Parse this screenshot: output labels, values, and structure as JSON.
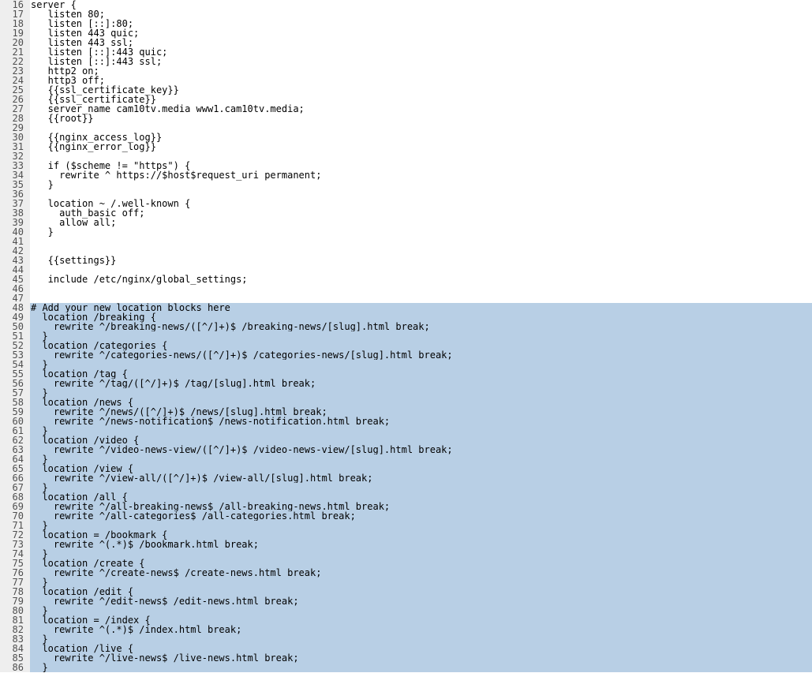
{
  "lines": [
    {
      "num": 16,
      "text": "server {",
      "hl": false
    },
    {
      "num": 17,
      "text": "   listen 80;",
      "hl": false
    },
    {
      "num": 18,
      "text": "   listen [::]:80;",
      "hl": false
    },
    {
      "num": 19,
      "text": "   listen 443 quic;",
      "hl": false
    },
    {
      "num": 20,
      "text": "   listen 443 ssl;",
      "hl": false
    },
    {
      "num": 21,
      "text": "   listen [::]:443 quic;",
      "hl": false
    },
    {
      "num": 22,
      "text": "   listen [::]:443 ssl;",
      "hl": false
    },
    {
      "num": 23,
      "text": "   http2 on;",
      "hl": false
    },
    {
      "num": 24,
      "text": "   http3 off;",
      "hl": false
    },
    {
      "num": 25,
      "text": "   {{ssl_certificate_key}}",
      "hl": false
    },
    {
      "num": 26,
      "text": "   {{ssl_certificate}}",
      "hl": false
    },
    {
      "num": 27,
      "text": "   server_name cam10tv.media www1.cam10tv.media;",
      "hl": false
    },
    {
      "num": 28,
      "text": "   {{root}}",
      "hl": false
    },
    {
      "num": 29,
      "text": "",
      "hl": false
    },
    {
      "num": 30,
      "text": "   {{nginx_access_log}}",
      "hl": false
    },
    {
      "num": 31,
      "text": "   {{nginx_error_log}}",
      "hl": false
    },
    {
      "num": 32,
      "text": "",
      "hl": false
    },
    {
      "num": 33,
      "text": "   if ($scheme != \"https\") {",
      "hl": false
    },
    {
      "num": 34,
      "text": "     rewrite ^ https://$host$request_uri permanent;",
      "hl": false
    },
    {
      "num": 35,
      "text": "   }",
      "hl": false
    },
    {
      "num": 36,
      "text": "",
      "hl": false
    },
    {
      "num": 37,
      "text": "   location ~ /.well-known {",
      "hl": false
    },
    {
      "num": 38,
      "text": "     auth_basic off;",
      "hl": false
    },
    {
      "num": 39,
      "text": "     allow all;",
      "hl": false
    },
    {
      "num": 40,
      "text": "   }",
      "hl": false
    },
    {
      "num": 41,
      "text": "",
      "hl": false
    },
    {
      "num": 42,
      "text": "",
      "hl": false
    },
    {
      "num": 43,
      "text": "   {{settings}}",
      "hl": false
    },
    {
      "num": 44,
      "text": "",
      "hl": false
    },
    {
      "num": 45,
      "text": "   include /etc/nginx/global_settings;",
      "hl": false
    },
    {
      "num": 46,
      "text": "",
      "hl": false
    },
    {
      "num": 47,
      "text": "",
      "hl": true
    },
    {
      "num": 48,
      "text": "# Add your new location blocks here",
      "hl": true
    },
    {
      "num": 49,
      "text": "  location /breaking {",
      "hl": true
    },
    {
      "num": 50,
      "text": "    rewrite ^/breaking-news/([^/]+)$ /breaking-news/[slug].html break;",
      "hl": true
    },
    {
      "num": 51,
      "text": "  }",
      "hl": true
    },
    {
      "num": 52,
      "text": "  location /categories {",
      "hl": true
    },
    {
      "num": 53,
      "text": "    rewrite ^/categories-news/([^/]+)$ /categories-news/[slug].html break;",
      "hl": true
    },
    {
      "num": 54,
      "text": "  }",
      "hl": true
    },
    {
      "num": 55,
      "text": "  location /tag {",
      "hl": true
    },
    {
      "num": 56,
      "text": "    rewrite ^/tag/([^/]+)$ /tag/[slug].html break;",
      "hl": true
    },
    {
      "num": 57,
      "text": "  }",
      "hl": true
    },
    {
      "num": 58,
      "text": "  location /news {",
      "hl": true
    },
    {
      "num": 59,
      "text": "    rewrite ^/news/([^/]+)$ /news/[slug].html break;",
      "hl": true
    },
    {
      "num": 60,
      "text": "    rewrite ^/news-notification$ /news-notification.html break;",
      "hl": true
    },
    {
      "num": 61,
      "text": "  }",
      "hl": true
    },
    {
      "num": 62,
      "text": "  location /video {",
      "hl": true
    },
    {
      "num": 63,
      "text": "    rewrite ^/video-news-view/([^/]+)$ /video-news-view/[slug].html break;",
      "hl": true
    },
    {
      "num": 64,
      "text": "  }",
      "hl": true
    },
    {
      "num": 65,
      "text": "  location /view {",
      "hl": true
    },
    {
      "num": 66,
      "text": "    rewrite ^/view-all/([^/]+)$ /view-all/[slug].html break;",
      "hl": true
    },
    {
      "num": 67,
      "text": "  }",
      "hl": true
    },
    {
      "num": 68,
      "text": "  location /all {",
      "hl": true
    },
    {
      "num": 69,
      "text": "    rewrite ^/all-breaking-news$ /all-breaking-news.html break;",
      "hl": true
    },
    {
      "num": 70,
      "text": "    rewrite ^/all-categories$ /all-categories.html break;",
      "hl": true
    },
    {
      "num": 71,
      "text": "  }",
      "hl": true
    },
    {
      "num": 72,
      "text": "  location = /bookmark {",
      "hl": true
    },
    {
      "num": 73,
      "text": "    rewrite ^(.*)$ /bookmark.html break;",
      "hl": true
    },
    {
      "num": 74,
      "text": "  }",
      "hl": true
    },
    {
      "num": 75,
      "text": "  location /create {",
      "hl": true
    },
    {
      "num": 76,
      "text": "    rewrite ^/create-news$ /create-news.html break;",
      "hl": true
    },
    {
      "num": 77,
      "text": "  }",
      "hl": true
    },
    {
      "num": 78,
      "text": "  location /edit {",
      "hl": true
    },
    {
      "num": 79,
      "text": "    rewrite ^/edit-news$ /edit-news.html break;",
      "hl": true
    },
    {
      "num": 80,
      "text": "  }",
      "hl": true
    },
    {
      "num": 81,
      "text": "  location = /index {",
      "hl": true
    },
    {
      "num": 82,
      "text": "    rewrite ^(.*)$ /index.html break;",
      "hl": true
    },
    {
      "num": 83,
      "text": "  }",
      "hl": true
    },
    {
      "num": 84,
      "text": "  location /live {",
      "hl": true
    },
    {
      "num": 85,
      "text": "    rewrite ^/live-news$ /live-news.html break;",
      "hl": true
    },
    {
      "num": 86,
      "text": "  }",
      "hl": true
    }
  ]
}
